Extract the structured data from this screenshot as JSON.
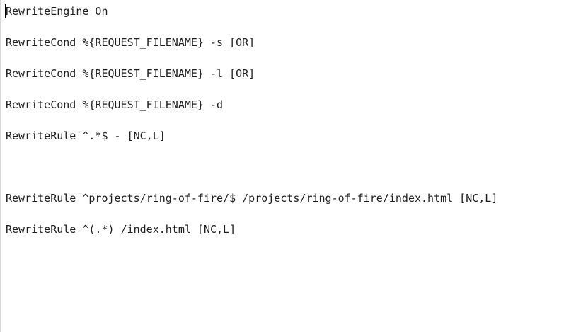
{
  "editor": {
    "lines": [
      "RewriteEngine On",
      "RewriteCond %{REQUEST_FILENAME} -s [OR]",
      "RewriteCond %{REQUEST_FILENAME} -l [OR]",
      "RewriteCond %{REQUEST_FILENAME} -d",
      "RewriteRule ^.*$ - [NC,L]",
      "",
      "RewriteRule ^projects/ring-of-fire/$ /projects/ring-of-fire/index.html [NC,L]",
      "RewriteRule ^(.*) /index.html [NC,L]"
    ]
  }
}
